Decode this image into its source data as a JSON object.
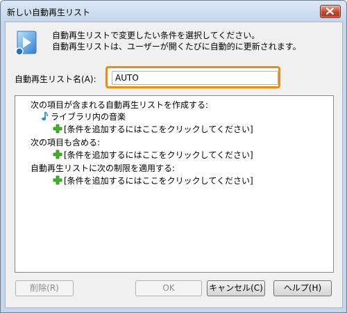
{
  "window": {
    "title": "新しい自動再生リスト"
  },
  "description": {
    "line1": "自動再生リストで変更したい条件を選択してください。",
    "line2": "自動再生リストは、ユーザーが開くたびに自動的に更新されます。"
  },
  "name_field": {
    "label": "自動再生リスト名(A):",
    "value": "AUTO"
  },
  "criteria": {
    "create_heading": "次の項目が含まれる自動再生リストを作成する:",
    "library_item": "ライブラリ内の音楽",
    "add_condition_1": "[条件を追加するにはここをクリックしてください]",
    "include_heading": "次の項目も含める:",
    "add_condition_2": "[条件を追加するにはここをクリックしてください]",
    "limit_heading": "自動再生リストに次の制限を適用する:",
    "add_condition_3": "[条件を追加するにはここをクリックしてください]"
  },
  "buttons": {
    "delete": "削除(R)",
    "ok": "OK",
    "cancel": "キャンセル(C)",
    "help": "ヘルプ(H)"
  },
  "colors": {
    "highlight_border": "#f08a10",
    "plus_icon": "#3fb22a",
    "note_icon": "#2a8bd6"
  },
  "icons": {
    "app": "media-player-icon",
    "close": "close-icon",
    "note": "music-note-icon",
    "add": "plus-icon"
  }
}
